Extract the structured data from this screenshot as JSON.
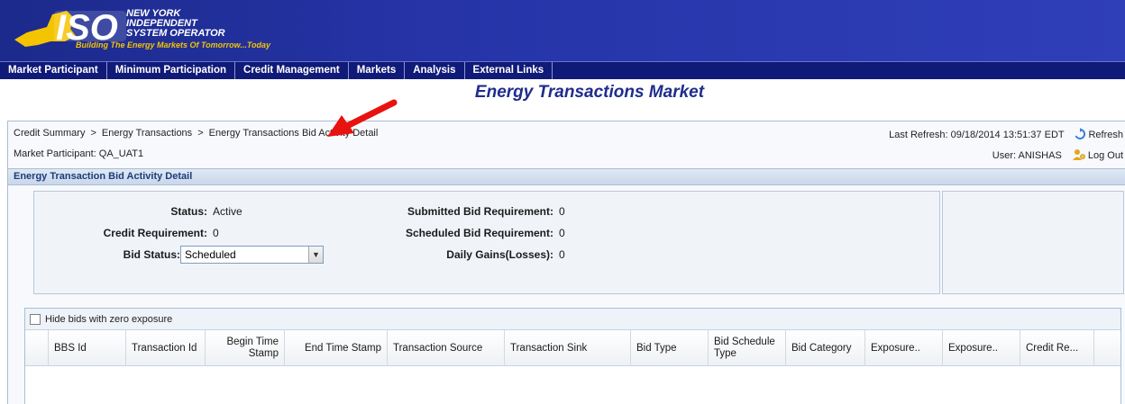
{
  "header": {
    "logo_name_line1": "NEW YORK",
    "logo_name_line2": "INDEPENDENT",
    "logo_name_line3": "SYSTEM OPERATOR",
    "logo_mark": "ISO",
    "tagline": "Building The Energy Markets Of Tomorrow...Today"
  },
  "menu": [
    {
      "label": "Market Participant"
    },
    {
      "label": "Minimum Participation"
    },
    {
      "label": "Credit Management"
    },
    {
      "label": "Markets"
    },
    {
      "label": "Analysis"
    },
    {
      "label": "External Links"
    }
  ],
  "page_title": "Energy Transactions Market",
  "breadcrumb": {
    "items": [
      "Credit Summary",
      "Energy Transactions",
      "Energy Transactions Bid Activity Detail"
    ],
    "separator": ">"
  },
  "market_participant": "Market Participant: QA_UAT1",
  "last_refresh": "Last Refresh: 09/18/2014 13:51:37 EDT",
  "refresh_label": "Refresh",
  "user": "User: ANISHAS",
  "logout_label": "Log Out",
  "section_title": "Energy Transaction Bid Activity Detail",
  "summary": {
    "status_label": "Status:",
    "status_value": "Active",
    "credit_req_label": "Credit Requirement:",
    "credit_req_value": "0",
    "bid_status_label": "Bid Status:",
    "bid_status_value": "Scheduled",
    "submitted_label": "Submitted Bid Requirement:",
    "submitted_value": "0",
    "scheduled_label": "Scheduled Bid Requirement:",
    "scheduled_value": "0",
    "daily_label": "Daily Gains(Losses):",
    "daily_value": "0"
  },
  "grid": {
    "hide_zero_label": "Hide bids with zero exposure",
    "hide_zero_checked": false,
    "columns": [
      {
        "label": "BBS Id",
        "align": "left"
      },
      {
        "label": "Transaction Id",
        "align": "left"
      },
      {
        "label": "Begin Time Stamp",
        "align": "right"
      },
      {
        "label": "End Time Stamp",
        "align": "right"
      },
      {
        "label": "Transaction Source",
        "align": "left"
      },
      {
        "label": "Transaction Sink",
        "align": "left"
      },
      {
        "label": "Bid Type",
        "align": "left"
      },
      {
        "label": "Bid Schedule Type",
        "align": "left"
      },
      {
        "label": "Bid Category",
        "align": "left"
      },
      {
        "label": "Exposure..",
        "align": "left"
      },
      {
        "label": "Exposure..",
        "align": "left"
      },
      {
        "label": "Credit Re...",
        "align": "left"
      }
    ]
  },
  "colors": {
    "banner": "#2634a8",
    "menubar": "#101a78",
    "title": "#1f2d8c",
    "annotation_arrow": "#e8130f",
    "tagline": "#f5c400"
  }
}
